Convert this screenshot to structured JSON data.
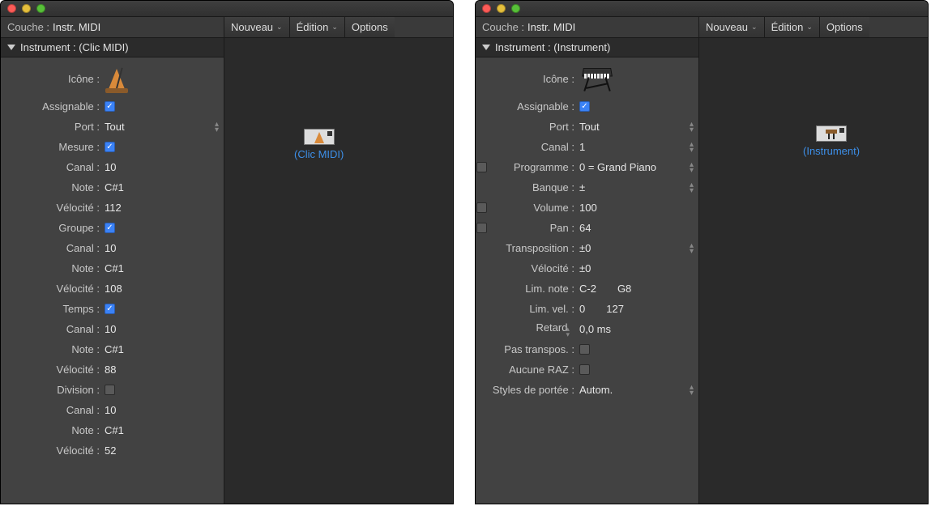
{
  "left": {
    "layer_label": "Couche :",
    "layer_value": "Instr. MIDI",
    "toolbar": {
      "new": "Nouveau",
      "edit": "Édition",
      "options": "Options"
    },
    "inspector_title": "Instrument : (Clic MIDI)",
    "icon_label": "Icône :",
    "rows": [
      {
        "label": "Assignable :",
        "type": "check",
        "checked": true
      },
      {
        "label": "Port :",
        "type": "select",
        "value": "Tout"
      },
      {
        "label": "Mesure :",
        "type": "check",
        "checked": true
      },
      {
        "label": "Canal :",
        "type": "text",
        "value": "10"
      },
      {
        "label": "Note :",
        "type": "text",
        "value": "C#1"
      },
      {
        "label": "Vélocité :",
        "type": "text",
        "value": "112"
      },
      {
        "label": "Groupe :",
        "type": "check",
        "checked": true
      },
      {
        "label": "Canal :",
        "type": "text",
        "value": "10"
      },
      {
        "label": "Note :",
        "type": "text",
        "value": "C#1"
      },
      {
        "label": "Vélocité :",
        "type": "text",
        "value": "108"
      },
      {
        "label": "Temps :",
        "type": "check",
        "checked": true
      },
      {
        "label": "Canal :",
        "type": "text",
        "value": "10"
      },
      {
        "label": "Note :",
        "type": "text",
        "value": "C#1"
      },
      {
        "label": "Vélocité :",
        "type": "text",
        "value": "88"
      },
      {
        "label": "Division :",
        "type": "check",
        "checked": false
      },
      {
        "label": "Canal :",
        "type": "text",
        "value": "10"
      },
      {
        "label": "Note :",
        "type": "text",
        "value": "C#1"
      },
      {
        "label": "Vélocité :",
        "type": "text",
        "value": "52"
      }
    ],
    "canvas_object": "(Clic MIDI)"
  },
  "right": {
    "layer_label": "Couche :",
    "layer_value": "Instr. MIDI",
    "toolbar": {
      "new": "Nouveau",
      "edit": "Édition",
      "options": "Options"
    },
    "inspector_title": "Instrument : (Instrument)",
    "icon_label": "Icône :",
    "rows": [
      {
        "label": "Assignable :",
        "type": "check",
        "checked": true,
        "pre": false
      },
      {
        "label": "Port :",
        "type": "select",
        "value": "Tout",
        "pre": false
      },
      {
        "label": "Canal :",
        "type": "select",
        "value": "1",
        "pre": false
      },
      {
        "label": "Programme :",
        "type": "select",
        "value": "0 = Grand Piano",
        "pre": true,
        "prechecked": false
      },
      {
        "label": "Banque :",
        "type": "select",
        "value": "±",
        "pre": false
      },
      {
        "label": "Volume :",
        "type": "text",
        "value": "100",
        "pre": true,
        "prechecked": false
      },
      {
        "label": "Pan :",
        "type": "text",
        "value": "64",
        "pre": true,
        "prechecked": false
      },
      {
        "label": "Transposition :",
        "type": "select",
        "value": "±0",
        "pre": false
      },
      {
        "label": "Vélocité :",
        "type": "text",
        "value": "±0",
        "pre": false
      },
      {
        "label": "Lim. note :",
        "type": "text",
        "value": "C-2  G8",
        "pre": false
      },
      {
        "label": "Lim. vel. :",
        "type": "text",
        "value": "0  127",
        "pre": false
      },
      {
        "label": "Retard",
        "type": "selecttext",
        "value": "0,0 ms",
        "pre": false
      },
      {
        "label": "Pas transpos. :",
        "type": "check",
        "checked": false,
        "pre": false
      },
      {
        "label": "Aucune RAZ :",
        "type": "check",
        "checked": false,
        "pre": false
      },
      {
        "label": "Styles de portée :",
        "type": "select",
        "value": "Autom.",
        "pre": false
      }
    ],
    "canvas_object": "(Instrument)"
  }
}
